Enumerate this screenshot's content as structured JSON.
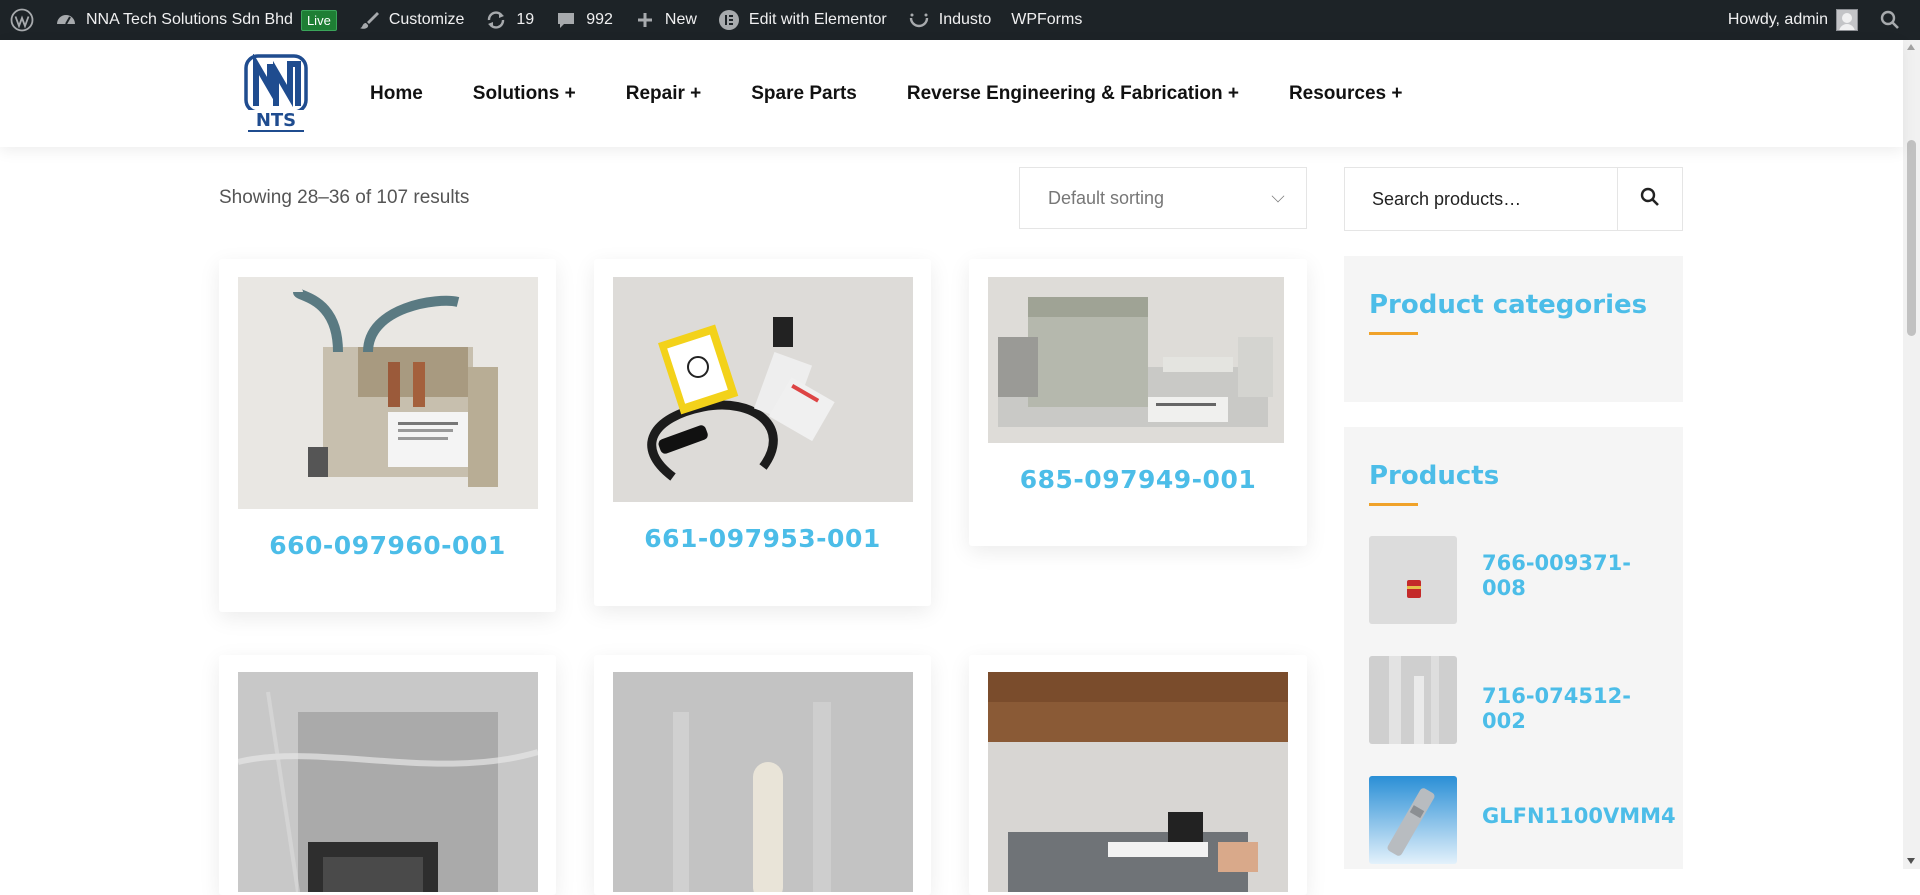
{
  "admin_bar": {
    "site_name": "NNA Tech Solutions Sdn Bhd",
    "live_badge": "Live",
    "customize": "Customize",
    "updates_count": "19",
    "comments_count": "992",
    "new_label": "New",
    "elementor_label": "Edit with Elementor",
    "theme_label": "Industo",
    "wpforms_label": "WPForms",
    "greeting": "Howdy, admin"
  },
  "header": {
    "logo_text": "NTS",
    "nav": [
      "Home",
      "Solutions +",
      "Repair +",
      "Spare Parts",
      "Reverse Engineering & Fabrication +",
      "Resources +"
    ]
  },
  "shop": {
    "result_count": "Showing 28–36 of 107 results",
    "sorting": "Default sorting",
    "products": [
      {
        "title": "660-097960-001"
      },
      {
        "title": "661-097953-001"
      },
      {
        "title": "685-097949-001"
      }
    ]
  },
  "sidebar": {
    "search_placeholder": "Search products…",
    "categories_title": "Product categories",
    "products_title": "Products",
    "products": [
      {
        "name": "766-009371-008"
      },
      {
        "name": "716-074512-002"
      },
      {
        "name": "GLFN1100VMM4"
      }
    ]
  },
  "colors": {
    "accent": "#4cbde8",
    "underline": "#f0a229",
    "admin_bar": "#1d2327",
    "live_badge": "#1e7e34"
  }
}
